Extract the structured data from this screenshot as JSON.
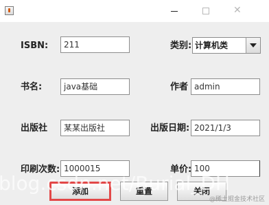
{
  "window": {
    "title": ""
  },
  "icons": {
    "app": "java-icon",
    "minimize": "minimize-icon",
    "maximize": "maximize-icon",
    "close": "close-icon"
  },
  "window_controls": {
    "close_glyph": "✕"
  },
  "form": {
    "isbn": {
      "label": "ISBN:",
      "value": "211"
    },
    "category": {
      "label": "类别:",
      "value": "计算机类"
    },
    "book_name": {
      "label": "书名:",
      "value": "java基础"
    },
    "author": {
      "label": "作者",
      "value": "admin"
    },
    "publisher": {
      "label": "出版社",
      "value": "某某出版社"
    },
    "publish_date": {
      "label": "出版日期:",
      "value": "2021/1/3"
    },
    "print_count": {
      "label": "印刷次数:",
      "value": "1000015"
    },
    "price": {
      "label": "单价:",
      "value": "100"
    }
  },
  "buttons": {
    "add": "添加",
    "reset": "重置",
    "close": "关闭"
  },
  "overlay": {
    "watermark": "blog.csdn.net/Burial_DH",
    "badge": "@稀土掘金技术社区"
  },
  "colors": {
    "highlight_border": "#e24848",
    "window_bg": "#eeeeee"
  }
}
